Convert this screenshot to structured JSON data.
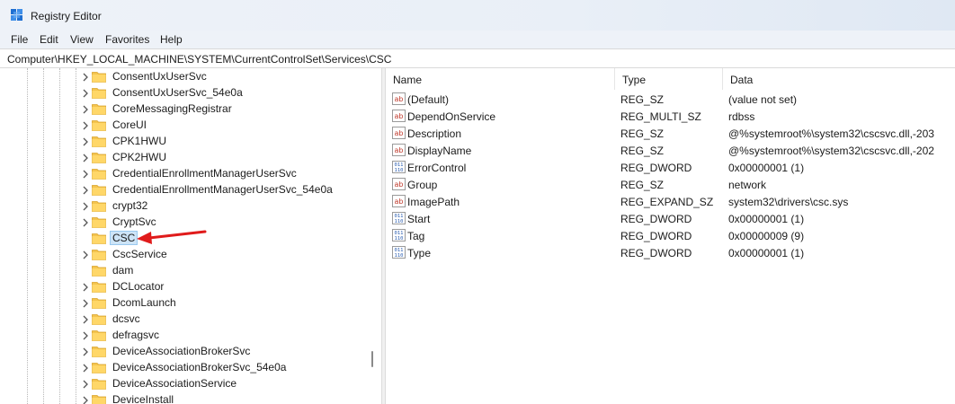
{
  "window": {
    "title": "Registry Editor"
  },
  "menu": [
    "File",
    "Edit",
    "View",
    "Favorites",
    "Help"
  ],
  "address": {
    "path": "Computer\\HKEY_LOCAL_MACHINE\\SYSTEM\\CurrentControlSet\\Services\\CSC"
  },
  "tree": {
    "items": [
      {
        "label": "ConsentUxUserSvc",
        "expandable": true
      },
      {
        "label": "ConsentUxUserSvc_54e0a",
        "expandable": true
      },
      {
        "label": "CoreMessagingRegistrar",
        "expandable": true
      },
      {
        "label": "CoreUI",
        "expandable": true
      },
      {
        "label": "CPK1HWU",
        "expandable": true
      },
      {
        "label": "CPK2HWU",
        "expandable": true
      },
      {
        "label": "CredentialEnrollmentManagerUserSvc",
        "expandable": true
      },
      {
        "label": "CredentialEnrollmentManagerUserSvc_54e0a",
        "expandable": true
      },
      {
        "label": "crypt32",
        "expandable": true
      },
      {
        "label": "CryptSvc",
        "expandable": true
      },
      {
        "label": "CSC",
        "expandable": false,
        "selected": true
      },
      {
        "label": "CscService",
        "expandable": true
      },
      {
        "label": "dam",
        "expandable": false
      },
      {
        "label": "DCLocator",
        "expandable": true
      },
      {
        "label": "DcomLaunch",
        "expandable": true
      },
      {
        "label": "dcsvc",
        "expandable": true
      },
      {
        "label": "defragsvc",
        "expandable": true
      },
      {
        "label": "DeviceAssociationBrokerSvc",
        "expandable": true
      },
      {
        "label": "DeviceAssociationBrokerSvc_54e0a",
        "expandable": true
      },
      {
        "label": "DeviceAssociationService",
        "expandable": true
      },
      {
        "label": "DeviceInstall",
        "expandable": true
      }
    ]
  },
  "values": {
    "columns": {
      "name": "Name",
      "type": "Type",
      "data": "Data"
    },
    "rows": [
      {
        "icon": "string-value-icon",
        "name": "(Default)",
        "type": "REG_SZ",
        "data": "(value not set)"
      },
      {
        "icon": "string-value-icon",
        "name": "DependOnService",
        "type": "REG_MULTI_SZ",
        "data": "rdbss"
      },
      {
        "icon": "string-value-icon",
        "name": "Description",
        "type": "REG_SZ",
        "data": "@%systemroot%\\system32\\cscsvc.dll,-203"
      },
      {
        "icon": "string-value-icon",
        "name": "DisplayName",
        "type": "REG_SZ",
        "data": "@%systemroot%\\system32\\cscsvc.dll,-202"
      },
      {
        "icon": "binary-value-icon",
        "name": "ErrorControl",
        "type": "REG_DWORD",
        "data": "0x00000001 (1)"
      },
      {
        "icon": "string-value-icon",
        "name": "Group",
        "type": "REG_SZ",
        "data": "network"
      },
      {
        "icon": "string-value-icon",
        "name": "ImagePath",
        "type": "REG_EXPAND_SZ",
        "data": "system32\\drivers\\csc.sys"
      },
      {
        "icon": "binary-value-icon",
        "name": "Start",
        "type": "REG_DWORD",
        "data": "0x00000001 (1)"
      },
      {
        "icon": "binary-value-icon",
        "name": "Tag",
        "type": "REG_DWORD",
        "data": "0x00000009 (9)"
      },
      {
        "icon": "binary-value-icon",
        "name": "Type",
        "type": "REG_DWORD",
        "data": "0x00000001 (1)"
      }
    ]
  },
  "colors": {
    "folder": "#f4c44e",
    "selection": "#cde4f7",
    "arrow": "#e01b1b",
    "string_icon": "#c0392b",
    "binary_icon": "#2a5db0"
  }
}
